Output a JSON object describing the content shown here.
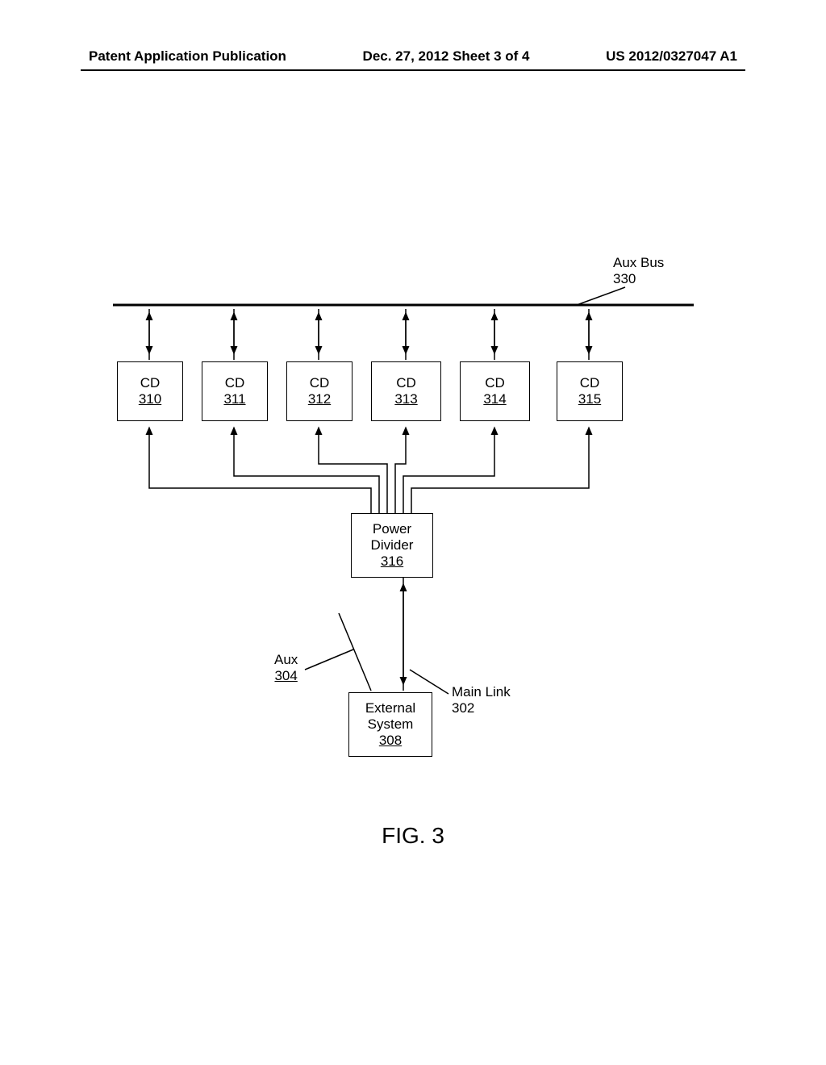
{
  "header": {
    "left": "Patent Application Publication",
    "center": "Dec. 27, 2012  Sheet 3 of 4",
    "right": "US 2012/0327047 A1"
  },
  "aux_bus": {
    "label": "Aux Bus",
    "num": "330"
  },
  "cd_blocks": [
    {
      "label": "CD",
      "num": "310"
    },
    {
      "label": "CD",
      "num": "311"
    },
    {
      "label": "CD",
      "num": "312"
    },
    {
      "label": "CD",
      "num": "313"
    },
    {
      "label": "CD",
      "num": "314"
    },
    {
      "label": "CD",
      "num": "315"
    }
  ],
  "power_divider": {
    "l1": "Power",
    "l2": "Divider",
    "num": "316"
  },
  "ext_sys": {
    "l1": "External",
    "l2": "System",
    "num": "308"
  },
  "aux_label": {
    "label": "Aux",
    "num": "304"
  },
  "main_link": {
    "label": "Main Link",
    "num": "302"
  },
  "figure": "FIG. 3"
}
